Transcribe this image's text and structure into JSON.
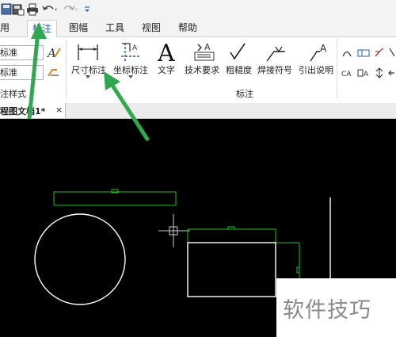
{
  "tabs": [
    {
      "label": "常用",
      "shown": "常用",
      "active": false
    },
    {
      "label": "标注",
      "active": true
    },
    {
      "label": "图幅",
      "active": false
    },
    {
      "label": "工具",
      "active": false
    },
    {
      "label": "视图",
      "active": false
    },
    {
      "label": "帮助",
      "active": false
    }
  ],
  "tab_first_visible": "用",
  "ribbon": {
    "style_combo1": "标准",
    "style_combo2": "标准",
    "style_group_label": "注样式",
    "tools": [
      {
        "label": "尺寸标注",
        "icon": "dimension-icon",
        "dropdown": true
      },
      {
        "label": "坐标标注",
        "icon": "coordinate-dimension-icon",
        "dropdown": true
      },
      {
        "label": "文字",
        "icon": "text-A-icon"
      },
      {
        "label": "技术要求",
        "icon": "technical-requirements-icon"
      },
      {
        "label": "粗糙度",
        "icon": "roughness-icon"
      },
      {
        "label": "焊接符号",
        "icon": "weld-symbol-icon"
      },
      {
        "label": "引出说明",
        "icon": "leader-note-icon"
      }
    ],
    "group_label": "标注"
  },
  "document_tab": {
    "title": "程图文档1*",
    "close": "×"
  },
  "watermark": "软件技巧",
  "colors": {
    "ui_bg": "#f3f3f3",
    "canvas": "#000000",
    "accent": "#1f5fa8",
    "annotation_arrow": "#2fa84f",
    "dimension_green": "#22c122",
    "entity_white": "#ffffff"
  }
}
